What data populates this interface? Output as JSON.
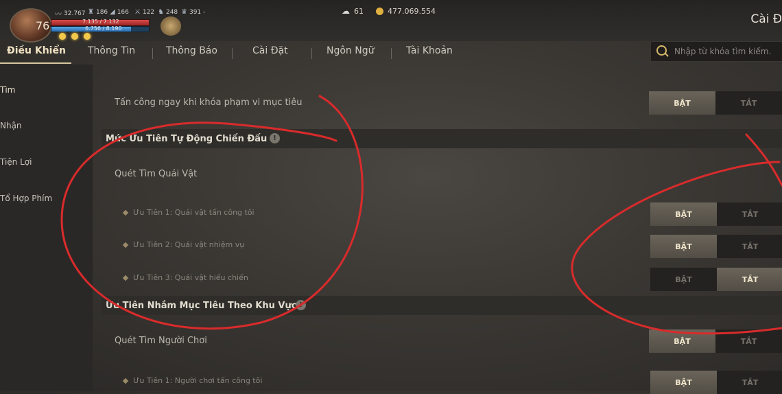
{
  "player": {
    "level": "76",
    "stats": [
      "32.767",
      "186",
      "166",
      "122",
      "248",
      "391 -"
    ],
    "hp_text": "7.135 / 7.132",
    "mp_text": "6.756 / 8.190",
    "mp_fill": 0.82
  },
  "currency": {
    "gems": "61",
    "gold": "477.069.554"
  },
  "window_title": "Cài Đ",
  "tabs": [
    "Điều Khiển",
    "Thông Tin",
    "Thông Báo",
    "Cài Đặt",
    "Ngôn Ngữ",
    "Tài Khoản"
  ],
  "search": {
    "placeholder": "Nhập từ khóa tìm kiếm."
  },
  "sidebar": [
    "Tìm",
    "Nhận",
    "Tiện Lợi",
    "Tổ Hợp Phím"
  ],
  "settings": {
    "attack_on_lock": "Tấn công ngay khi khóa phạm vi mục tiêu",
    "section1": "Mức Ưu Tiên Tự Động Chiến Đấu",
    "scan_monsters": "Quét Tìm Quái Vật",
    "p1": "Ưu Tiên 1: Quái vật tấn công tôi",
    "p2": "Ưu Tiên 2: Quái vật nhiệm vụ",
    "p3": "Ưu Tiên 3: Quái vật hiếu chiến",
    "section2": "Ưu Tiên Nhắm Mục Tiêu Theo Khu Vực",
    "scan_players": "Quét Tìm Người Chơi",
    "pp1": "Ưu Tiên 1: Người chơi tấn công tôi"
  },
  "toggle": {
    "on": "BẬT",
    "off": "TẮT"
  },
  "info_glyph": "!",
  "colors": {
    "accent": "#d8c8a0",
    "annotation": "#d92b2b"
  }
}
